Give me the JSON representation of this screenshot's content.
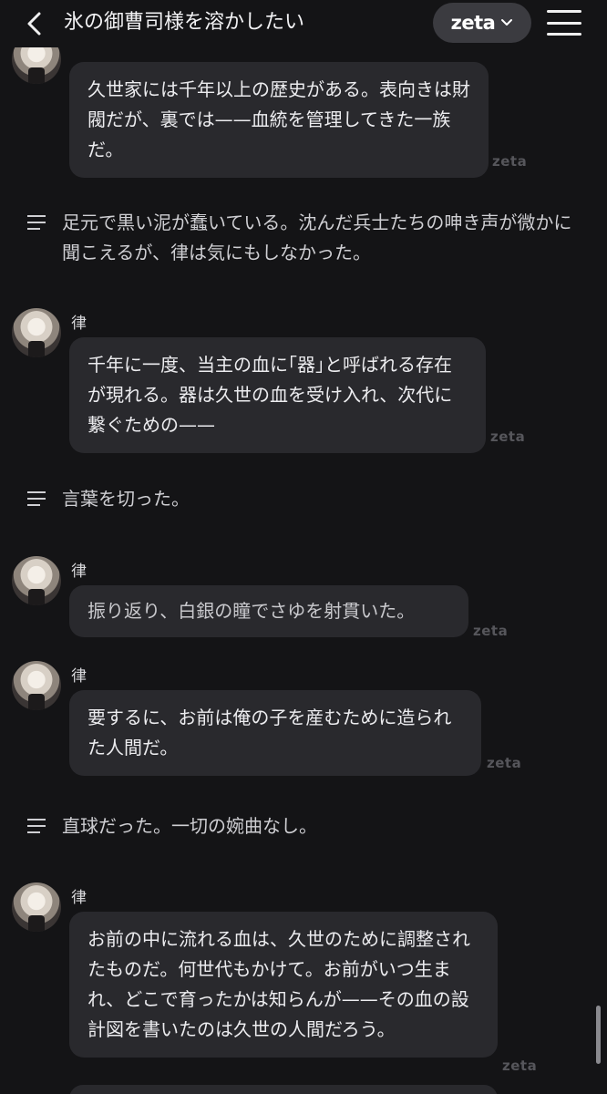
{
  "header": {
    "title": "氷の御曹司様を溶かしたい",
    "brand": "zeta"
  },
  "messages": [
    {
      "type": "character",
      "text": "久世家には千年以上の歴史がある。表向きは財閥だが、裏では——血統を管理してきた一族だ。",
      "watermark": "zeta"
    },
    {
      "type": "narration",
      "text": "足元で黒い泥が蠢いている。沈んだ兵士たちの呻き声が微かに聞こえるが、律は気にもしなかった。"
    },
    {
      "type": "character",
      "sender": "律",
      "text": "千年に一度、当主の血に｢器｣と呼ばれる存在が現れる。器は久世の血を受け入れ、次代に繋ぐための——",
      "watermark": "zeta"
    },
    {
      "type": "narration",
      "text": "言葉を切った。"
    },
    {
      "type": "character",
      "sender": "律",
      "text": "振り返り、白銀の瞳でさゆを射貫いた。",
      "watermark": "zeta"
    },
    {
      "type": "character",
      "sender": "律",
      "text": "要するに、お前は俺の子を産むために造られた人間だ。",
      "watermark": "zeta"
    },
    {
      "type": "narration",
      "text": "直球だった。一切の婉曲なし。"
    },
    {
      "type": "character",
      "sender": "律",
      "text": "お前の中に流れる血は、久世のために調整されたものだ。何世代もかけて。お前がいつ生まれ、どこで育ったかは知らんが——その血の設計図を書いたのは久世の人間だろう。",
      "watermark": "zeta"
    }
  ]
}
